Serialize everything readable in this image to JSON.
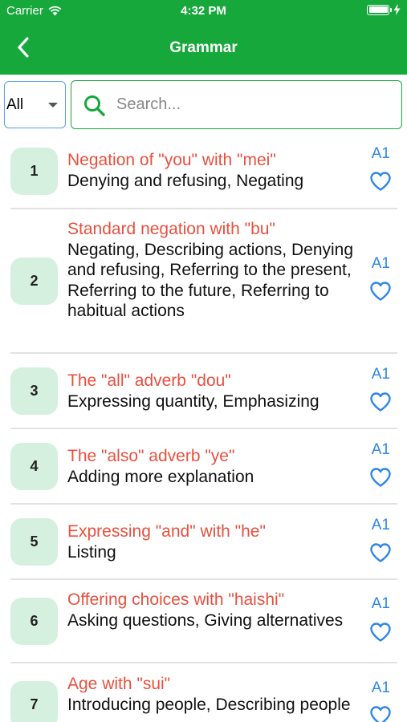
{
  "status": {
    "carrier": "Carrier",
    "time": "4:32 PM"
  },
  "nav": {
    "title": "Grammar",
    "back_icon": "chevron-left-icon"
  },
  "filter": {
    "level_value": "All",
    "search_placeholder": "Search..."
  },
  "colors": {
    "brand": "#17a83c",
    "title": "#e8503f",
    "level": "#2e86e8",
    "badge": "#d6f0df"
  },
  "items": [
    {
      "number": "1",
      "title": "Negation of \"you\" with \"mei\"",
      "tags": "Denying and refusing,  Negating",
      "level": "A1"
    },
    {
      "number": "2",
      "title": "Standard negation with \"bu\"",
      "tags": "Negating,  Describing actions,  Denying and refusing,  Referring to the present,  Referring to the future,  Referring to habitual actions",
      "level": "A1"
    },
    {
      "number": "3",
      "title": "The \"all\" adverb \"dou\"",
      "tags": "Expressing quantity,  Emphasizing",
      "level": "A1"
    },
    {
      "number": "4",
      "title": "The \"also\" adverb \"ye\"",
      "tags": "Adding more explanation",
      "level": "A1"
    },
    {
      "number": "5",
      "title": "Expressing \"and\" with \"he\"",
      "tags": "Listing",
      "level": "A1"
    },
    {
      "number": "6",
      "title": "Offering choices with \"haishi\"",
      "tags": "Asking questions,  Giving alternatives",
      "level": "A1"
    },
    {
      "number": "7",
      "title": "Age with \"sui\"",
      "tags": "Introducing people,  Describing people",
      "level": "A1"
    }
  ]
}
